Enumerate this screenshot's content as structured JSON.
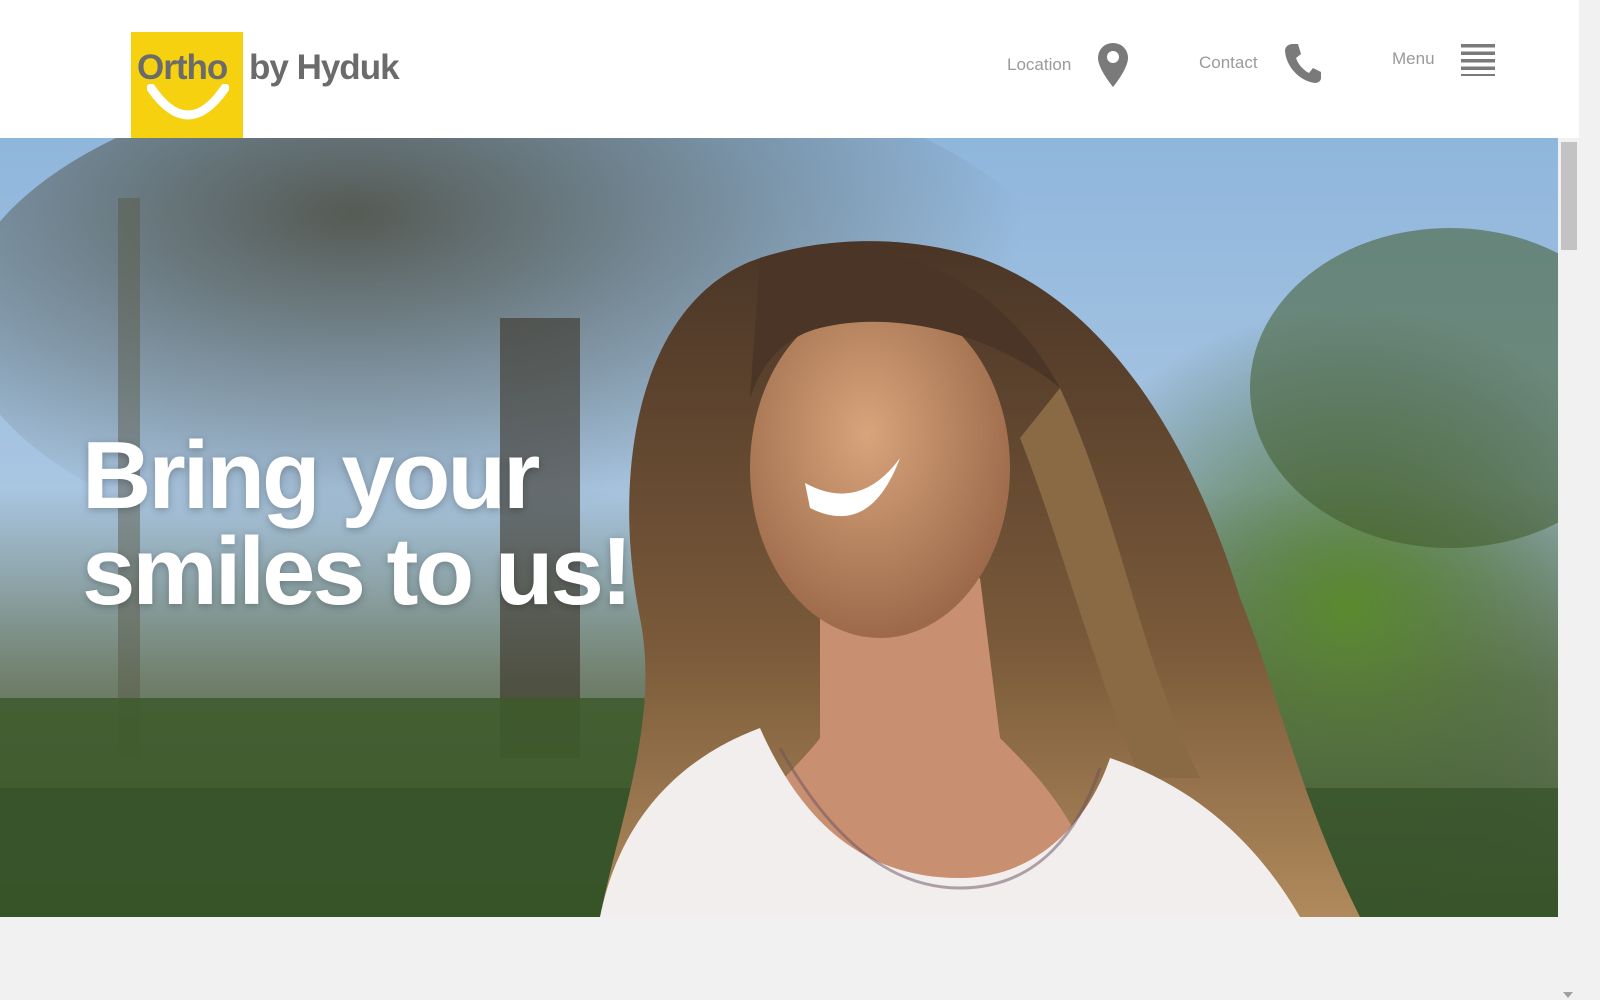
{
  "brand": {
    "logo_word": "Ortho",
    "logo_suffix": "by Hyduk",
    "logo_color": "#f5d10f",
    "text_color": "#6b6b6b"
  },
  "nav": {
    "location": {
      "label": "Location",
      "icon": "map-pin-icon"
    },
    "contact": {
      "label": "Contact",
      "icon": "phone-icon"
    },
    "menu": {
      "label": "Menu",
      "icon": "hamburger-icon"
    }
  },
  "hero": {
    "title_line1": "Bring your",
    "title_line2": "smiles to us!",
    "image": "smiling-woman-outdoors-photo"
  }
}
